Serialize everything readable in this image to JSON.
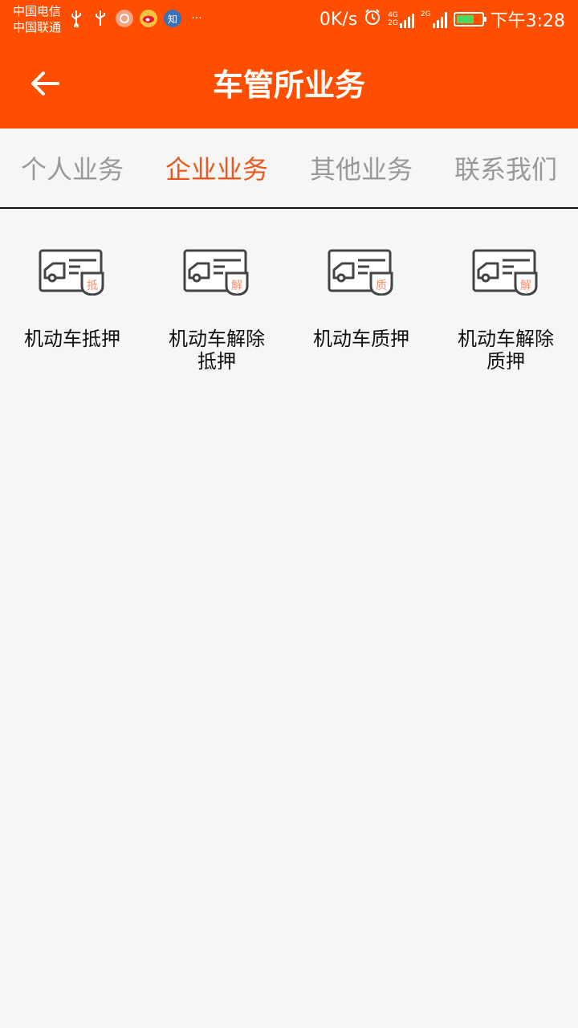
{
  "status_bar": {
    "carrier1": "中国电信",
    "carrier2": "中国联通",
    "icons": [
      "usb-icon",
      "usb-icon",
      "app-icon",
      "weibo-icon",
      "zhihu-icon",
      "more-dots-icon"
    ],
    "zhihu_label": "知",
    "more": "···",
    "net_speed": "0K/s",
    "net1_top": "4G",
    "net1_bottom": "2G",
    "net2": "2G",
    "time": "下午3:28"
  },
  "header": {
    "title": "车管所业务",
    "back_icon": "arrow-left-icon",
    "background": "#ff4e00"
  },
  "tabs": [
    {
      "label": "个人业务",
      "active": false
    },
    {
      "label": "企业业务",
      "active": true
    },
    {
      "label": "其他业务",
      "active": false
    },
    {
      "label": "联系我们",
      "active": false
    }
  ],
  "accent_color": "#ea5a1e",
  "services": [
    {
      "label": "机动车抵押",
      "badge": "抵",
      "icon": "vehicle-license-icon"
    },
    {
      "label": "机动车解除抵押",
      "badge": "解",
      "icon": "vehicle-license-icon"
    },
    {
      "label": "机动车质押",
      "badge": "质",
      "icon": "vehicle-license-icon"
    },
    {
      "label": "机动车解除质押",
      "badge": "解",
      "icon": "vehicle-license-icon"
    }
  ]
}
